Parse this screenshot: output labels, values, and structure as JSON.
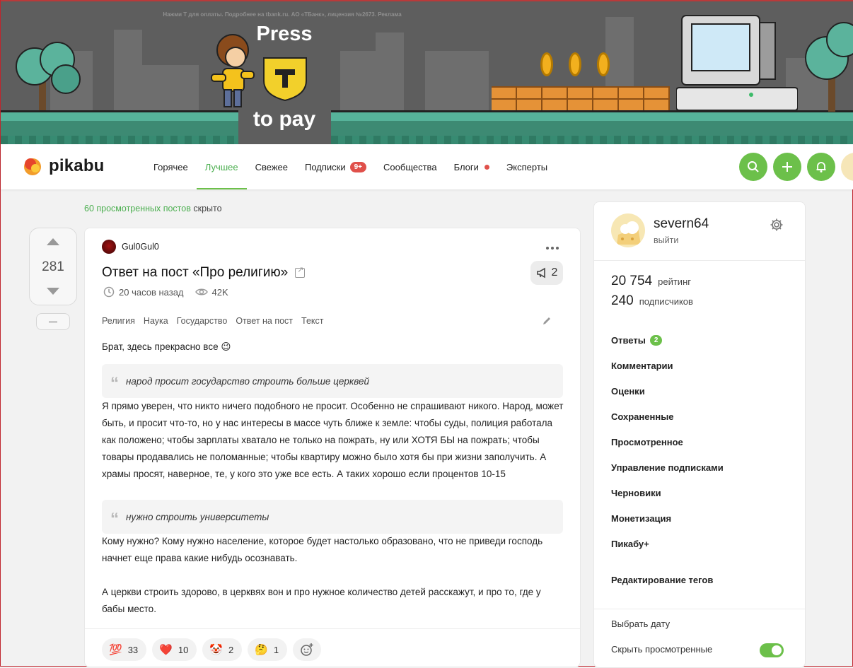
{
  "banner": {
    "ad_note": "Нажми Т для оплаты. Подробнее на tbank.ru. АО «ТБанк», лицензия №2673. Реклама",
    "press": "Press",
    "to_pay": "to pay",
    "shield_letter": "T"
  },
  "header": {
    "logo": "pikabu",
    "nav": [
      {
        "label": "Горячее"
      },
      {
        "label": "Лучшее",
        "active": true
      },
      {
        "label": "Свежее"
      },
      {
        "label": "Подписки",
        "badge": "9+"
      },
      {
        "label": "Сообщества"
      },
      {
        "label": "Блоги",
        "dot": true
      },
      {
        "label": "Эксперты"
      }
    ],
    "buttons": [
      "search-icon",
      "plus-icon",
      "bell-icon"
    ]
  },
  "feed": {
    "hidden_link": "60 просмотренных постов",
    "hidden_suffix": " скрыто"
  },
  "post": {
    "rating": "281",
    "author": "Gul0Gul0",
    "title": "Ответ на пост «Про религию»",
    "comments": "2",
    "time": "20 часов назад",
    "views": "42K",
    "tags": [
      "Религия",
      "Наука",
      "Государство",
      "Ответ на пост",
      "Текст"
    ],
    "intro": "Брат, здесь прекрасно все 😉",
    "quote1": "народ просит государство строить больше церквей",
    "para1": "Я прямо уверен, что никто ничего подобного не просит. Особенно не спрашивают никого. Народ, может быть, и просит что-то, но у нас интересы в массе чуть ближе к земле: чтобы суды, полиция работала как положено; чтобы зарплаты хватало не только на пожрать, ну или ХОТЯ БЫ на пожрать; чтобы товары продавались не поломанные; чтобы квартиру можно было хотя бы при жизни заполучить. А храмы просят, наверное, те, у кого это уже все есть. А таких хорошо если процентов 10-15",
    "quote2": "нужно строить университеты",
    "para2": "Кому нужно? Кому нужно население, которое будет настолько образовано, что не приведи господь начнет еще права какие нибудь осознавать.",
    "para3": "А церкви строить здорово, в церквях вон и про нужное количество детей расскажут, и про то, где у бабы место.",
    "reactions": [
      {
        "emoji": "💯",
        "count": "33"
      },
      {
        "emoji": "❤️",
        "count": "10"
      },
      {
        "emoji": "🤡",
        "count": "2"
      },
      {
        "emoji": "🤔",
        "count": "1"
      }
    ]
  },
  "sidebar": {
    "username": "severn64",
    "logout": "выйти",
    "rating_value": "20 754",
    "rating_label": "рейтинг",
    "subs_value": "240",
    "subs_label": "подписчиков",
    "menu": [
      {
        "label": "Ответы",
        "badge": "2"
      },
      {
        "label": "Комментарии"
      },
      {
        "label": "Оценки"
      },
      {
        "label": "Сохраненные"
      },
      {
        "label": "Просмотренное"
      },
      {
        "label": "Управление подписками"
      },
      {
        "label": "Черновики"
      },
      {
        "label": "Монетизация"
      },
      {
        "label": "Пикабу+"
      }
    ],
    "edit_tags": "Редактирование тегов",
    "pick_date": "Выбрать дату",
    "hide_viewed": "Скрыть просмотренные",
    "hide_viewed_on": true
  },
  "colors": {
    "accent": "#6cc04a",
    "badge_red": "#e0504a",
    "banner_bg": "#5e5e5e"
  }
}
